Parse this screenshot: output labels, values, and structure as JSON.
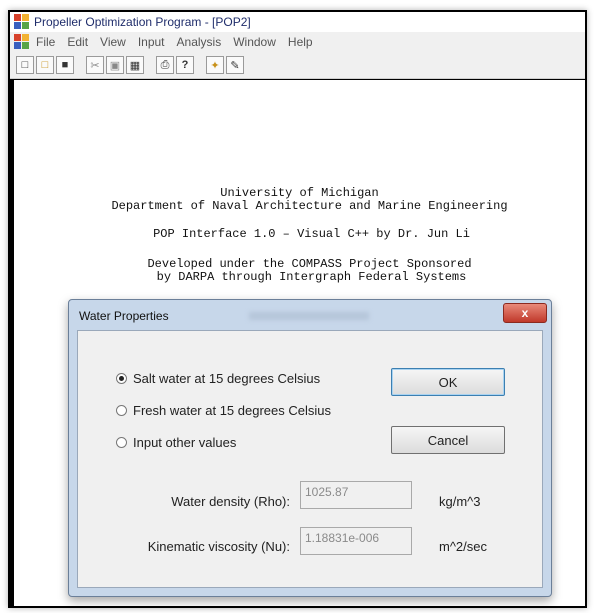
{
  "window": {
    "title": "Propeller Optimization Program - [POP2]"
  },
  "menubar": {
    "items": [
      "File",
      "Edit",
      "View",
      "Input",
      "Analysis",
      "Window",
      "Help"
    ]
  },
  "toolbar": {
    "icons": [
      "new-icon",
      "open-icon",
      "save-icon",
      "cut-icon",
      "copy-icon",
      "paste-icon",
      "print-icon",
      "help-icon",
      "tool-icon",
      "edit-icon"
    ]
  },
  "document": {
    "line1": "University of Michigan",
    "line2": "Department of Naval Architecture and Marine Engineering",
    "line3": "POP Interface 1.0 – Visual C++ by Dr. Jun Li",
    "line4": "Developed under the COMPASS Project Sponsored",
    "line5": "by DARPA through Intergraph Federal Systems"
  },
  "dialog": {
    "title": "Water Properties",
    "close_label": "x",
    "options": [
      {
        "label": "Salt water at 15 degrees Celsius",
        "checked": true
      },
      {
        "label": "Fresh water at 15 degrees Celsius",
        "checked": false
      },
      {
        "label": "Input other values",
        "checked": false
      }
    ],
    "ok_label": "OK",
    "cancel_label": "Cancel",
    "density_label": "Water density (Rho):",
    "density_value": "1025.87",
    "density_unit": "kg/m^3",
    "viscosity_label": "Kinematic viscosity (Nu):",
    "viscosity_value": "1.18831e-006",
    "viscosity_unit": "m^2/sec"
  },
  "colors": {
    "dialog_frame": "#c7d7ea",
    "close_button": "#c0392b",
    "title_text": "#1f2d6b"
  }
}
